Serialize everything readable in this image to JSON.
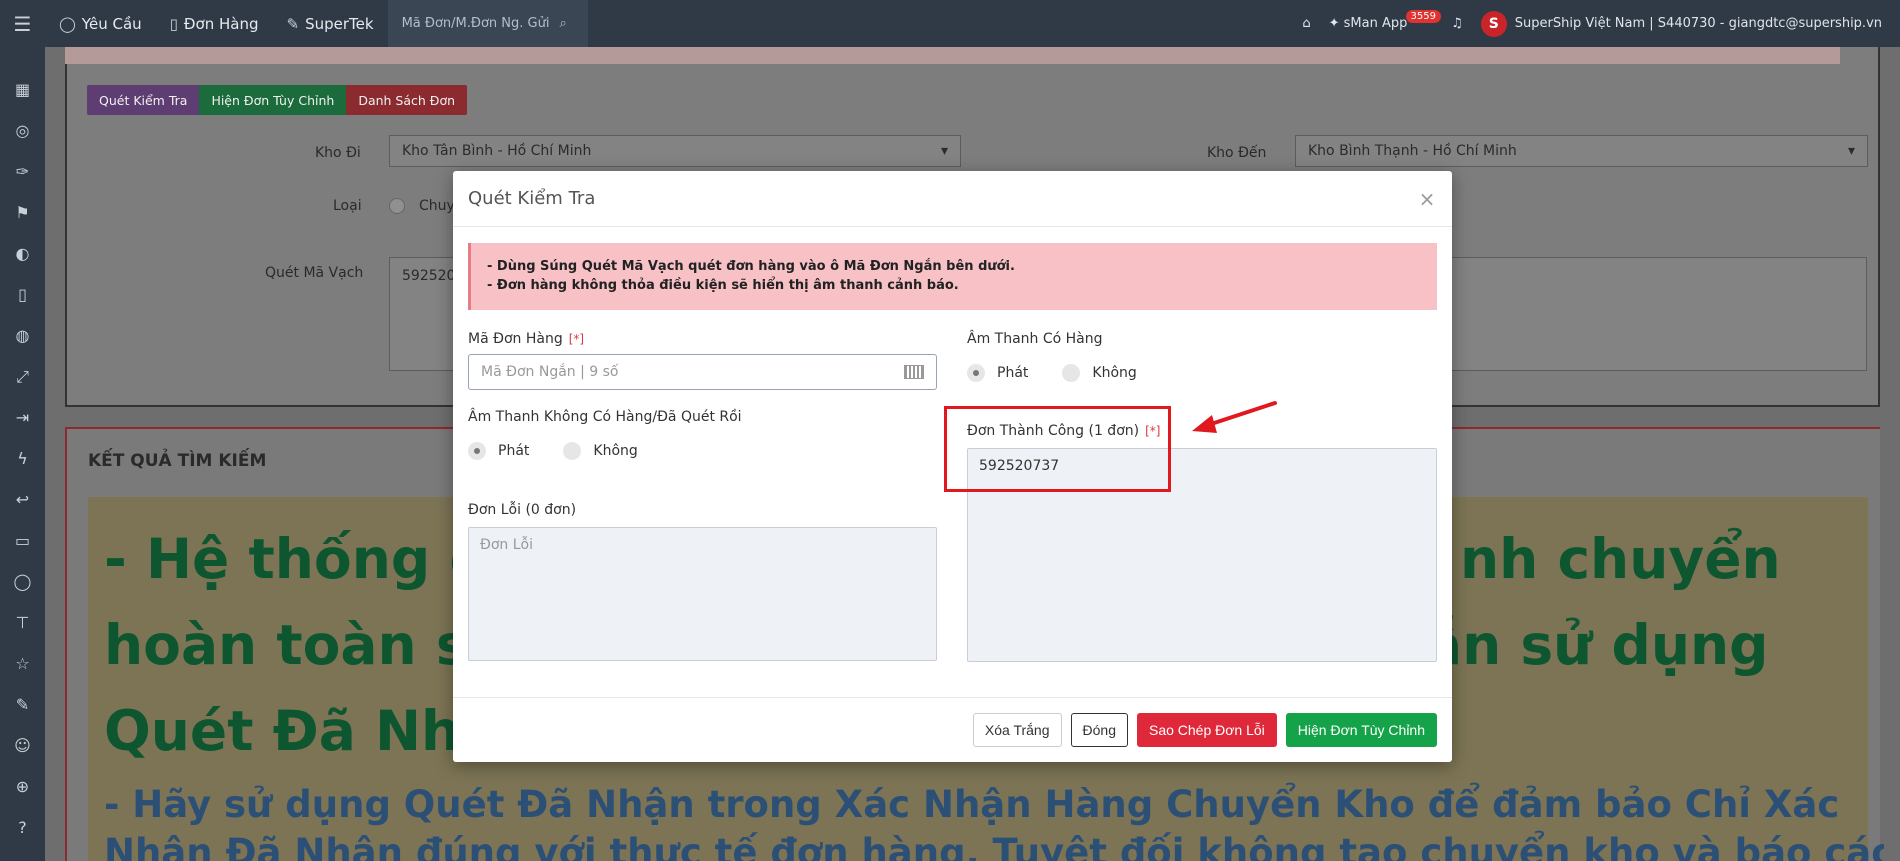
{
  "topbar": {
    "nav": [
      {
        "icon": "chat-icon",
        "label": "Yêu Cầu"
      },
      {
        "icon": "book-icon",
        "label": "Đơn Hàng"
      },
      {
        "icon": "edit-icon",
        "label": "SuperTek"
      }
    ],
    "search_placeholder": "Mã Đơn/M.Đơn Ng. Gửi",
    "app_label": "sMan App",
    "notification_count": "3559",
    "account": "SuperShip Việt Nam | S440730 - giangdtc@supership.vn"
  },
  "page": {
    "tabs": [
      "Quét Kiểm Tra",
      "Hiện Đơn Tùy Chỉnh",
      "Danh Sách Đơn"
    ],
    "kho_di_label": "Kho Đi",
    "kho_di_value": "Kho Tân Bình - Hồ Chí Minh",
    "kho_den_label": "Kho Đến",
    "kho_den_value": "Kho Bình Thạnh - Hồ Chí Minh",
    "loai_label": "Loại",
    "loai_value": "Chuy",
    "scan_label": "Quét Mã Vạch",
    "scan_value": "592520",
    "result_title": "KẾT QUẢ TÌM KIẾM",
    "big_line1": "- Hệ thống đ",
    "big_line1b": "nh chuyển",
    "big_line2": "hoàn toàn s",
    "big_line2b": "ẫn sử dụng",
    "big_line3": "Quét Đã Nh",
    "blue_line1": "- Hãy sử dụng Quét Đã Nhận trong Xác Nhận Hàng Chuyển Kho để đảm bảo Chỉ Xác",
    "blue_line2": "Nhận Đã Nhận đúng với thực tế đơn hàng. Tuyệt đối không tạo chuyển kho và báo cáo"
  },
  "modal": {
    "title": "Quét Kiểm Tra",
    "alert_line1": "- Dùng Súng Quét Mã Vạch quét đơn hàng vào ô Mã Đơn Ngắn bên dưới.",
    "alert_line2": "- Đơn hàng không thỏa điều kiện sẽ hiển thị âm thanh cảnh báo.",
    "order_code_label": "Mã Đơn Hàng",
    "required_mark": "[*]",
    "order_code_placeholder": "Mã Đơn Ngắn | 9 số",
    "sound_has_label": "Âm Thanh Có Hàng",
    "sound_none_label": "Âm Thanh Không Có Hàng/Đã Quét Rồi",
    "opt_play": "Phát",
    "opt_no": "Không",
    "success_label": "Đơn Thành Công (1 đơn)",
    "success_value": "592520737",
    "error_label": "Đơn Lỗi (0 đơn)",
    "error_placeholder": "Đơn Lỗi",
    "buttons": {
      "clear": "Xóa Trắng",
      "close": "Đóng",
      "copy_errors": "Sao Chép Đơn Lỗi",
      "show_custom": "Hiện Đơn Tùy Chỉnh"
    }
  },
  "colors": {
    "annotation_red": "#e0191f",
    "btn_red": "#e0283b",
    "btn_green": "#15a34a"
  }
}
